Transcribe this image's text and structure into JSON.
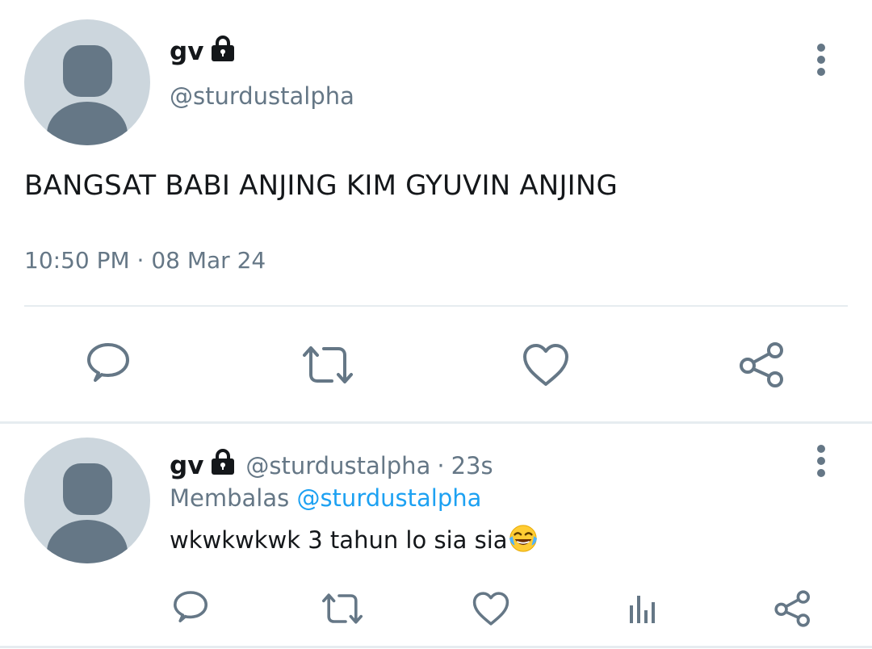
{
  "main_tweet": {
    "author_name": "gv",
    "author_handle": "@sturdustalpha",
    "text": "BANGSAT BABI ANJING KIM GYUVIN ANJING",
    "timestamp": "10:50 PM · 08 Mar 24",
    "actions": [
      "reply-icon",
      "retweet-icon",
      "like-icon",
      "share-icon"
    ]
  },
  "reply_tweet": {
    "author_name": "gv",
    "author_handle": "@sturdustalpha",
    "time_sep": "·",
    "time_ago": "23s",
    "replying_prefix": "Membalas",
    "replying_to": "@sturdustalpha",
    "text": "wkwkwkwk 3 tahun lo sia sia",
    "emoji": "face-with-tears-of-joy",
    "actions": [
      "reply-icon",
      "retweet-icon",
      "like-icon",
      "analytics-icon",
      "share-icon"
    ]
  },
  "colors": {
    "icon": "#657786",
    "link": "#1da1f2",
    "avatar_bg": "#ccd6dd",
    "divider": "#e6ecf0"
  }
}
